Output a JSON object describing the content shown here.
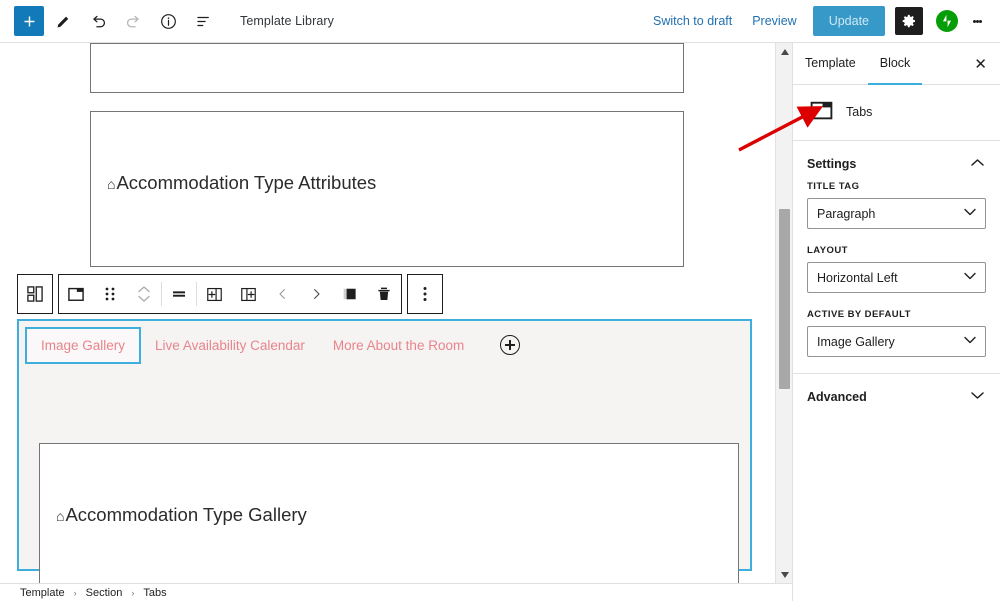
{
  "topbar": {
    "add_icon": "plus-icon",
    "edit_icon": "pencil-icon",
    "undo_icon": "undo-arrow-icon",
    "redo_icon": "redo-arrow-icon",
    "info_icon": "info-circle-icon",
    "listview_icon": "list-view-icon",
    "title": "Template Library",
    "switch_to_draft": "Switch to draft",
    "preview": "Preview",
    "update": "Update",
    "settings_icon": "gear-icon",
    "jetpack_icon": "jetpack-icon",
    "more_icon": "kebab-menu-icon",
    "update_bg": "#3699c8",
    "add_bg": "#127ab8",
    "link_color": "#2271b1"
  },
  "canvas": {
    "block_attributes_label": "Accommodation Type Attributes",
    "block_gallery_label": "Accommodation Type Gallery",
    "home_glyph": "⌂",
    "home_icon": "home-icon"
  },
  "block_toolbar": {
    "items": [
      {
        "name": "block-type-switcher-icon",
        "glyph": "blocks"
      },
      {
        "name": "tabs-block-icon",
        "glyph": "tabs"
      },
      {
        "name": "drag-handle-icon",
        "glyph": "drag"
      },
      {
        "name": "move-updown-icon",
        "glyph": "updown"
      },
      {
        "name": "align-icon",
        "glyph": "align"
      },
      {
        "name": "insert-tab-before-icon",
        "glyph": "insert-left"
      },
      {
        "name": "insert-tab-after-icon",
        "glyph": "insert-right"
      },
      {
        "name": "move-tab-left-icon",
        "glyph": "chev-left"
      },
      {
        "name": "move-tab-right-icon",
        "glyph": "chev-right"
      },
      {
        "name": "duplicate-icon",
        "glyph": "copy"
      },
      {
        "name": "delete-icon",
        "glyph": "trash"
      },
      {
        "name": "more-options-icon",
        "glyph": "kebab"
      }
    ]
  },
  "tabs_block": {
    "border_color": "#3eaedc",
    "tab_text_color": "#e8848c",
    "background": "#f6f3f3",
    "tabs": [
      {
        "label": "Image Gallery",
        "active": true
      },
      {
        "label": "Live Availability Calendar",
        "active": false
      },
      {
        "label": "More About the Room",
        "active": false
      }
    ],
    "add_tab_icon": "plus-circle-icon"
  },
  "sidebar": {
    "tabs": [
      {
        "label": "Template",
        "active": false
      },
      {
        "label": "Block",
        "active": true
      }
    ],
    "close_icon": "close-icon",
    "close_glyph": "✕",
    "block_name": "Tabs",
    "block_icon": "tabs-block-icon",
    "settings": {
      "title": "Settings",
      "collapse_glyph": "⌃",
      "fields": [
        {
          "label": "Title Tag",
          "value": "Paragraph",
          "name": "title-tag-select"
        },
        {
          "label": "Layout",
          "value": "Horizontal Left",
          "name": "layout-select"
        },
        {
          "label": "Active by default",
          "value": "Image Gallery",
          "name": "active-by-default-select"
        }
      ]
    },
    "advanced": {
      "title": "Advanced",
      "expand_glyph": "⌄"
    }
  },
  "breadcrumb": {
    "items": [
      "Template",
      "Section",
      "Tabs"
    ],
    "separator": "›"
  },
  "scrollbar": {
    "up_glyph": "▲",
    "down_glyph": "▼"
  },
  "annotation": {
    "color": "#dd0000",
    "type": "arrow-pointing-to-block-title"
  }
}
